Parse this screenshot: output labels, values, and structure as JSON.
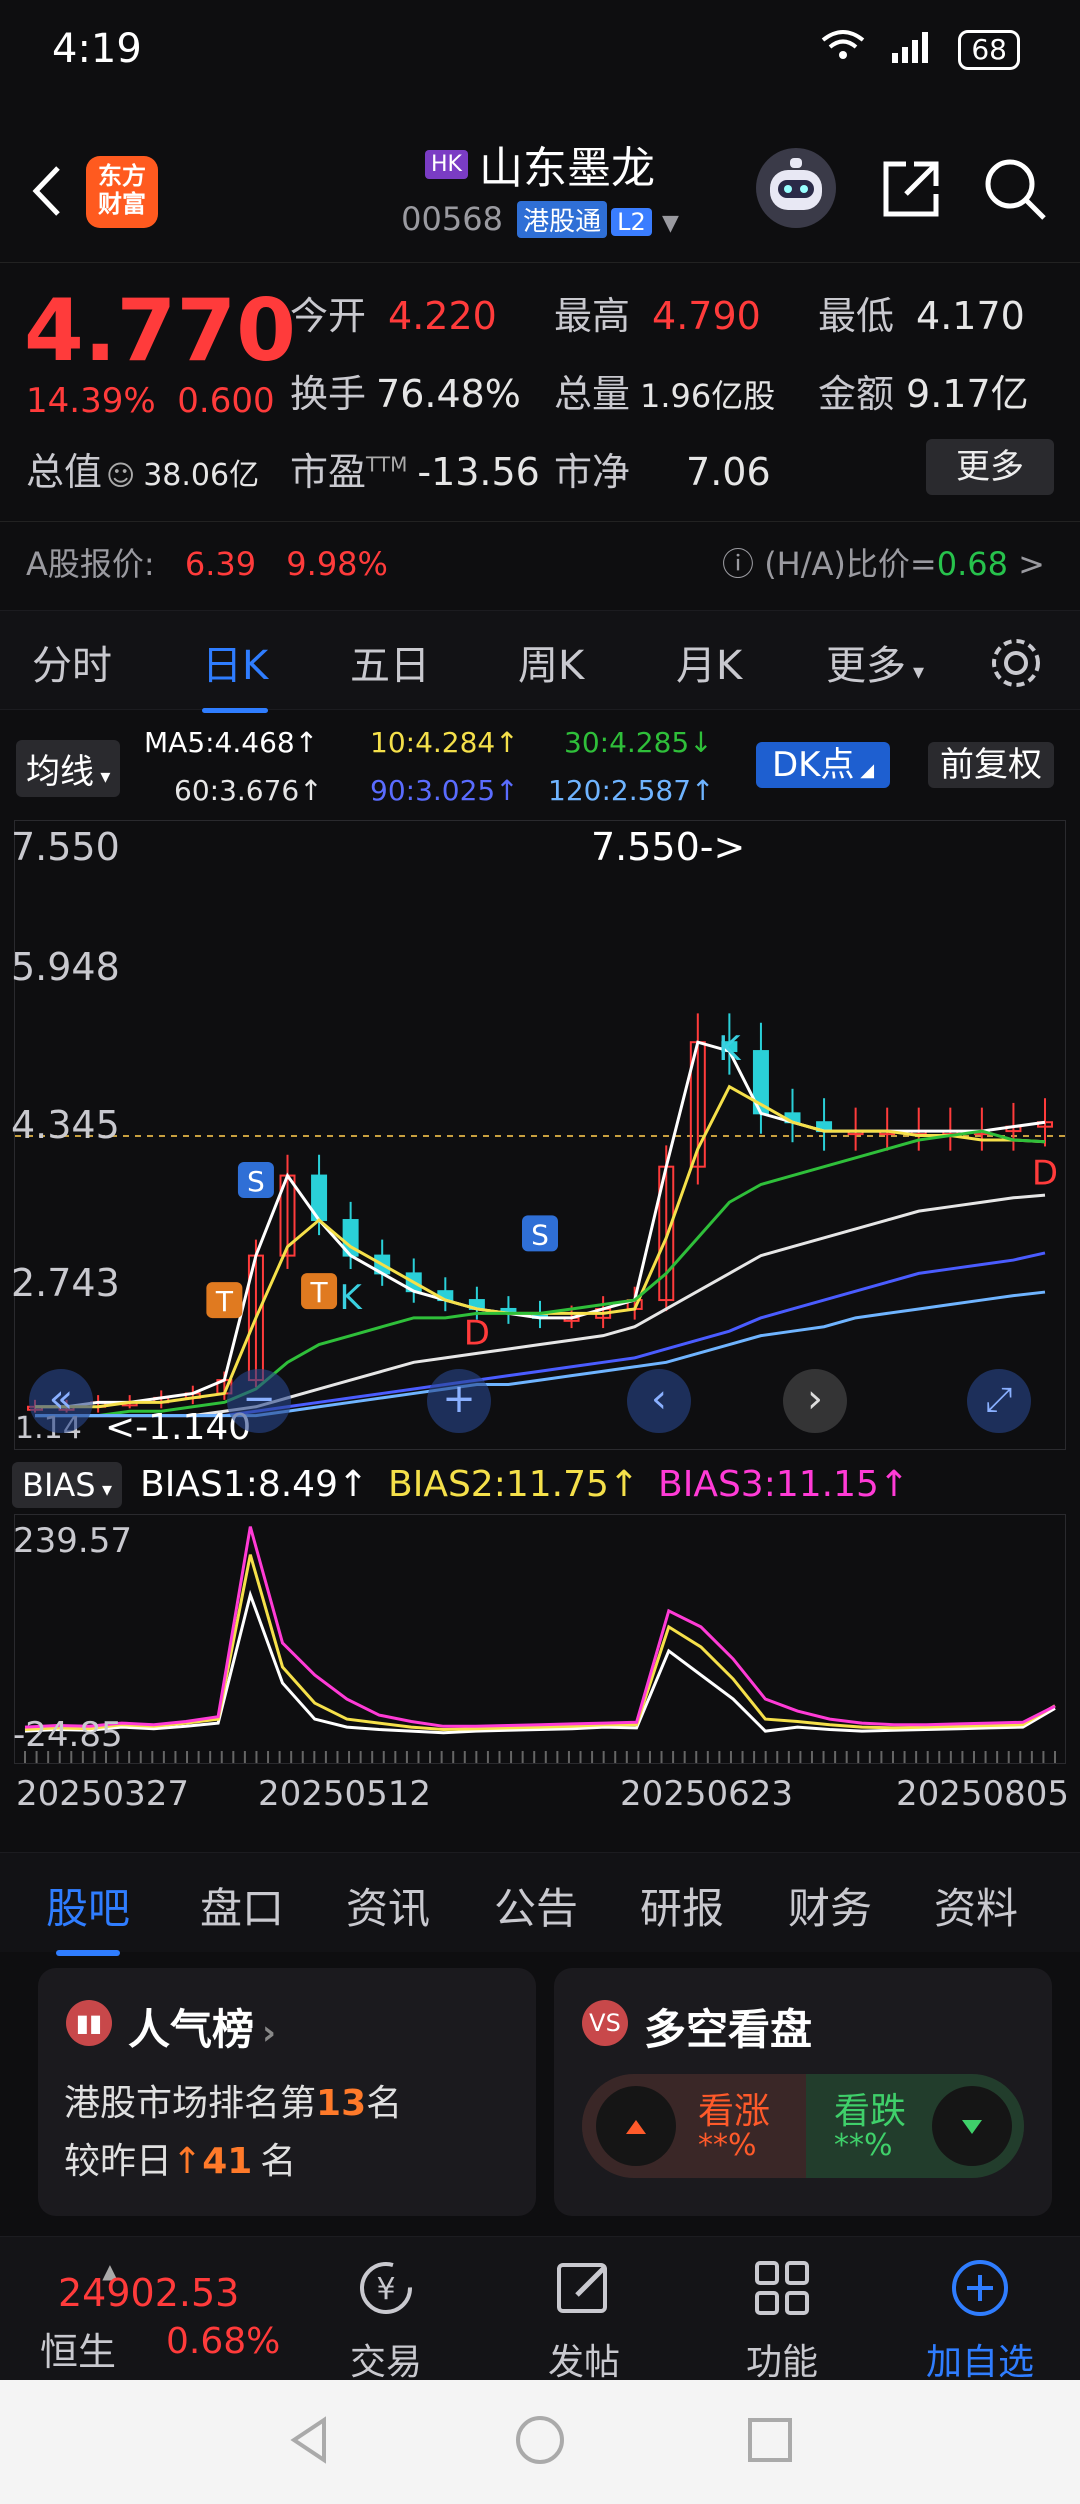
{
  "status": {
    "time": "4:19",
    "battery": "68"
  },
  "header": {
    "badge": "HK",
    "title": "山东墨龙",
    "code": "00568",
    "tag": "港股通",
    "level": "L2",
    "logo_l1": "东方",
    "logo_l2": "财富"
  },
  "quote": {
    "price": "4.770",
    "change_pct": "14.39%",
    "change": "0.600",
    "open_k": "今开",
    "open_v": "4.220",
    "high_k": "最高",
    "high_v": "4.790",
    "low_k": "最低",
    "low_v": "4.170",
    "turnover_k": "换手",
    "turnover_v": "76.48%",
    "volume_k": "总量",
    "volume_v": "1.96亿股",
    "amount_k": "金额",
    "amount_v": "9.17亿",
    "mktcap_k": "总值",
    "mktcap_v": "38.06亿",
    "pe_k": "市盈",
    "pe_sup": "TTM",
    "pe_v": "-13.56",
    "pb_k": "市净",
    "pb_v": "7.06",
    "more": "更多",
    "a_label": "A股报价:",
    "a_price": "6.39",
    "a_pct": "9.98%",
    "ha_label": "(H/A)比价=",
    "ha_value": "0.68",
    ">": ">"
  },
  "ktabs": [
    "分时",
    "日K",
    "五日",
    "周K",
    "月K",
    "更多"
  ],
  "ma": {
    "selector": "均线",
    "ma5": "MA5:4.468↑",
    "ma10": "10:4.284↑",
    "ma30": "30:4.285↓",
    "ma60": "60:3.676↑",
    "ma90": "90:3.025↑",
    "ma120": "120:2.587↑",
    "dk": "DK点",
    "fq": "前复权"
  },
  "colors": {
    "up": "#ff3b3b",
    "down": "#27c24c",
    "accent": "#2f7dff",
    "ma5": "#ffffff",
    "ma10": "#f5e04a",
    "ma30": "#2fbf3a",
    "ma60": "#e6e6e6",
    "ma90": "#4a5cff",
    "ma120": "#6fb4ff"
  },
  "chart_data": [
    {
      "type": "candlestick",
      "y_ticks": [
        "7.550",
        "5.948",
        "4.345",
        "2.743"
      ],
      "annotations": {
        "high": "7.550->",
        "low": "<-1.140",
        "last_price_line": 4.345,
        "low_left": "1.14"
      },
      "ylim": [
        1.14,
        7.55
      ],
      "series": [
        {
          "name": "MA5",
          "values": [
            1.3,
            1.3,
            1.35,
            1.35,
            1.4,
            1.45,
            1.6,
            3.0,
            3.9,
            3.4,
            3.0,
            2.8,
            2.6,
            2.5,
            2.4,
            2.35,
            2.3,
            2.3,
            2.4,
            2.5,
            4.0,
            5.4,
            5.3,
            4.6,
            4.5,
            4.4,
            4.4,
            4.4,
            4.4,
            4.4,
            4.4,
            4.45,
            4.5
          ]
        },
        {
          "name": "MA10",
          "values": [
            1.3,
            1.3,
            1.3,
            1.35,
            1.35,
            1.4,
            1.45,
            2.3,
            3.1,
            3.4,
            3.1,
            2.9,
            2.7,
            2.5,
            2.4,
            2.35,
            2.35,
            2.35,
            2.35,
            2.4,
            3.2,
            4.2,
            4.9,
            4.7,
            4.5,
            4.4,
            4.4,
            4.4,
            4.35,
            4.35,
            4.3,
            4.3,
            4.28
          ]
        },
        {
          "name": "MA30",
          "values": [
            1.2,
            1.2,
            1.2,
            1.25,
            1.25,
            1.3,
            1.35,
            1.5,
            1.8,
            2.0,
            2.1,
            2.2,
            2.3,
            2.3,
            2.35,
            2.35,
            2.35,
            2.4,
            2.45,
            2.5,
            2.8,
            3.2,
            3.6,
            3.8,
            3.9,
            4.0,
            4.1,
            4.2,
            4.3,
            4.35,
            4.4,
            4.3,
            4.28
          ]
        },
        {
          "name": "MA60",
          "values": [
            1.2,
            1.2,
            1.2,
            1.2,
            1.2,
            1.2,
            1.25,
            1.3,
            1.4,
            1.5,
            1.6,
            1.7,
            1.8,
            1.85,
            1.9,
            1.95,
            2.0,
            2.05,
            2.1,
            2.2,
            2.4,
            2.6,
            2.8,
            3.0,
            3.1,
            3.2,
            3.3,
            3.4,
            3.5,
            3.55,
            3.6,
            3.65,
            3.68
          ]
        },
        {
          "name": "MA90",
          "values": [
            1.2,
            1.2,
            1.2,
            1.2,
            1.2,
            1.2,
            1.2,
            1.25,
            1.3,
            1.35,
            1.4,
            1.45,
            1.5,
            1.55,
            1.6,
            1.65,
            1.7,
            1.75,
            1.8,
            1.85,
            1.95,
            2.05,
            2.15,
            2.3,
            2.4,
            2.5,
            2.6,
            2.7,
            2.8,
            2.85,
            2.9,
            2.95,
            3.03
          ]
        },
        {
          "name": "MA120",
          "values": [
            1.2,
            1.2,
            1.2,
            1.2,
            1.2,
            1.2,
            1.2,
            1.2,
            1.25,
            1.3,
            1.35,
            1.4,
            1.45,
            1.5,
            1.55,
            1.55,
            1.6,
            1.65,
            1.7,
            1.75,
            1.8,
            1.9,
            2.0,
            2.1,
            2.15,
            2.2,
            2.3,
            2.35,
            2.4,
            2.45,
            2.5,
            2.55,
            2.59
          ]
        }
      ],
      "markers": [
        {
          "label": "S",
          "i": 7,
          "y": 3.85
        },
        {
          "label": "T",
          "i": 6,
          "y": 2.5
        },
        {
          "label": "K",
          "i": 10,
          "y": 2.4
        },
        {
          "label": "T",
          "i": 9,
          "y": 2.6
        },
        {
          "label": "S",
          "i": 16,
          "y": 3.25
        },
        {
          "label": "K",
          "i": 22,
          "y": 5.2
        },
        {
          "label": "D",
          "i": 14,
          "y": 2.0
        },
        {
          "label": "D",
          "i": 32,
          "y": 3.8
        }
      ]
    },
    {
      "type": "line",
      "title": "BIAS",
      "y_ticks": [
        "239.57",
        "-24.85"
      ],
      "ylim": [
        -24.85,
        239.57
      ],
      "series": [
        {
          "name": "BIAS1",
          "values": [
            -20,
            -18,
            -19,
            -15,
            -17,
            -14,
            -10,
            150,
            40,
            -5,
            -15,
            -18,
            -20,
            -22,
            -20,
            -19,
            -18,
            -17,
            -15,
            -16,
            80,
            50,
            20,
            -20,
            -15,
            -18,
            -20,
            -19,
            -18,
            -17,
            -16,
            -15,
            8.49
          ]
        },
        {
          "name": "BIAS2",
          "values": [
            -18,
            -16,
            -17,
            -12,
            -14,
            -10,
            -5,
            200,
            60,
            15,
            -5,
            -10,
            -15,
            -18,
            -17,
            -16,
            -15,
            -14,
            -12,
            -12,
            110,
            85,
            45,
            -5,
            -8,
            -12,
            -15,
            -16,
            -15,
            -14,
            -13,
            -12,
            11.75
          ]
        },
        {
          "name": "BIAS3",
          "values": [
            -15,
            -13,
            -14,
            -10,
            -12,
            -8,
            -2,
            235,
            90,
            50,
            20,
            0,
            -8,
            -14,
            -14,
            -13,
            -12,
            -11,
            -10,
            -9,
            130,
            110,
            70,
            20,
            5,
            -5,
            -10,
            -12,
            -12,
            -11,
            -10,
            -9,
            11.15
          ]
        }
      ]
    }
  ],
  "bias": {
    "selector": "BIAS",
    "b1": "BIAS1:8.49↑",
    "b2": "BIAS2:11.75↑",
    "b3": "BIAS3:11.15↑"
  },
  "dates": [
    "20250327",
    "20250512",
    "20250623",
    "20250805"
  ],
  "btabs": [
    "股吧",
    "盘口",
    "资讯",
    "公告",
    "研报",
    "财务",
    "资料"
  ],
  "card1": {
    "title": "人气榜",
    "l1_pre": "港股市场排名第",
    "l1_num": "13",
    "l1_post": "名",
    "l2_pre": "较昨日",
    "l2_num": "41",
    "l2_post": "名"
  },
  "card2": {
    "title": "多空看盘",
    "up": "看涨",
    "up_pct": "**%",
    "down": "看跌",
    "down_pct": "**%"
  },
  "bnav": {
    "index_value": "24902.53",
    "index_name": "恒生",
    "index_pct": "0.68%",
    "trade": "交易",
    "post": "发帖",
    "func": "功能",
    "add": "加自选"
  }
}
